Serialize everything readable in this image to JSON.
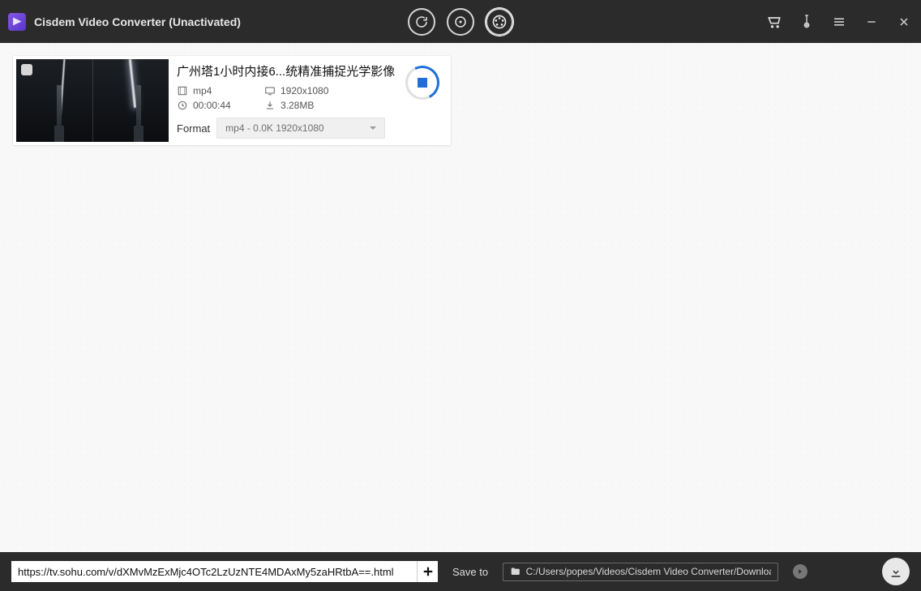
{
  "app": {
    "title": "Cisdem Video Converter (Unactivated)"
  },
  "modes": {
    "convert": "convert",
    "rip": "rip",
    "download": "download"
  },
  "video": {
    "title": "广州塔1小时内接6...统精准捕捉光学影像",
    "containerFormat": "mp4",
    "resolution": "1920x1080",
    "duration": "00:00:44",
    "filesize": "3.28MB",
    "formatLabel": "Format",
    "formatSelected": "mp4 - 0.0K 1920x1080"
  },
  "bottom": {
    "urlValue": "https://tv.sohu.com/v/dXMvMzExMjc4OTc2LzUzNTE4MDAxMy5zaHRtbA==.html",
    "saveToLabel": "Save to",
    "savePath": "C:/Users/popes/Videos/Cisdem Video Converter/Download"
  }
}
